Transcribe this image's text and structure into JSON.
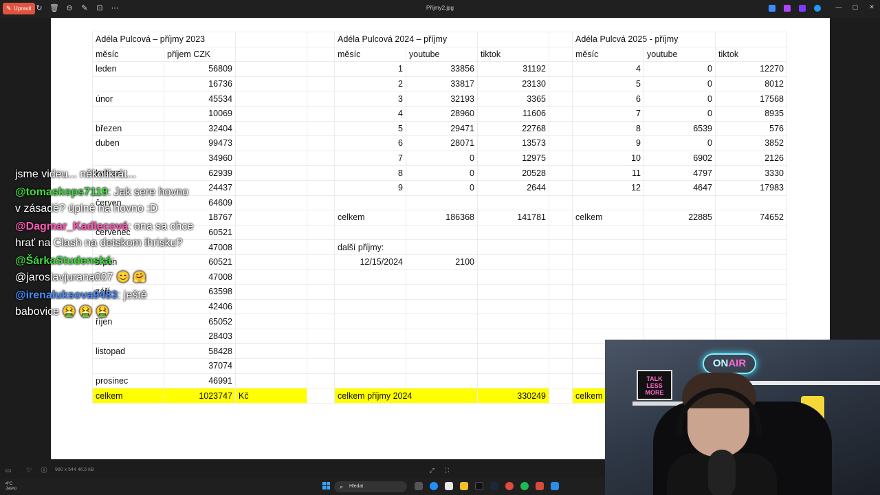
{
  "viewer": {
    "edit_label": "Upravit",
    "file_title": "Příjmy2.jpg",
    "image_info": "960 x 544   46.5 kB"
  },
  "sheet": {
    "t2023_title": "Adéla Pulcová – příjmy 2023",
    "t2024_title": "Adéla Pulcová 2024 – příjmy",
    "t2025_title": "Adéla Pulcvá 2025 - příjmy",
    "col_mesic": "měsíc",
    "col_prijem": "příjem CZK",
    "col_youtube": "youtube",
    "col_tiktok": "tiktok",
    "rows": [
      {
        "m23": "leden",
        "v23": "56809",
        "m24": "1",
        "y24": "33856",
        "t24": "31192",
        "m25": "4",
        "y25": "0",
        "t25": "12270"
      },
      {
        "m23": "",
        "v23": "16736",
        "m24": "2",
        "y24": "33817",
        "t24": "23130",
        "m25": "5",
        "y25": "0",
        "t25": "8012"
      },
      {
        "m23": "únor",
        "v23": "45534",
        "m24": "3",
        "y24": "32193",
        "t24": "3365",
        "m25": "6",
        "y25": "0",
        "t25": "17568"
      },
      {
        "m23": "",
        "v23": "10069",
        "m24": "4",
        "y24": "28960",
        "t24": "11606",
        "m25": "7",
        "y25": "0",
        "t25": "8935"
      },
      {
        "m23": "březen",
        "v23": "32404",
        "m24": "5",
        "y24": "29471",
        "t24": "22768",
        "m25": "8",
        "y25": "6539",
        "t25": "576"
      },
      {
        "m23": "duben",
        "v23": "99473",
        "m24": "6",
        "y24": "28071",
        "t24": "13573",
        "m25": "9",
        "y25": "0",
        "t25": "3852"
      },
      {
        "m23": "",
        "v23": "34960",
        "m24": "7",
        "y24": "0",
        "t24": "12975",
        "m25": "10",
        "y25": "6902",
        "t25": "2126"
      },
      {
        "m23": "květen",
        "v23": "62939",
        "m24": "8",
        "y24": "0",
        "t24": "20528",
        "m25": "11",
        "y25": "4797",
        "t25": "3330"
      },
      {
        "m23": "",
        "v23": "24437",
        "m24": "9",
        "y24": "0",
        "t24": "2644",
        "m25": "12",
        "y25": "4647",
        "t25": "17983"
      },
      {
        "m23": "červen",
        "v23": "64609",
        "m24": "",
        "y24": "",
        "t24": "",
        "m25": "",
        "y25": "",
        "t25": ""
      },
      {
        "m23": "",
        "v23": "18767",
        "m24": "celkem",
        "y24": "186368",
        "t24": "141781",
        "m25": "celkem",
        "y25": "22885",
        "t25": "74652"
      },
      {
        "m23": "červenec",
        "v23": "60521",
        "m24": "",
        "y24": "",
        "t24": "",
        "m25": "",
        "y25": "",
        "t25": ""
      },
      {
        "m23": "",
        "v23": "47008",
        "m24": "další příjmy:",
        "y24": "",
        "t24": "",
        "m25": "",
        "y25": "",
        "t25": ""
      },
      {
        "m23": "srpen",
        "v23": "60521",
        "m24": "12/15/2024",
        "y24": "2100",
        "t24": "",
        "m25": "",
        "y25": "",
        "t25": ""
      },
      {
        "m23": "",
        "v23": "47008",
        "m24": "",
        "y24": "",
        "t24": "",
        "m25": "",
        "y25": "",
        "t25": ""
      },
      {
        "m23": "září",
        "v23": "63598",
        "m24": "",
        "y24": "",
        "t24": "",
        "m25": "",
        "y25": "",
        "t25": ""
      },
      {
        "m23": "",
        "v23": "42406",
        "m24": "",
        "y24": "",
        "t24": "",
        "m25": "",
        "y25": "",
        "t25": ""
      },
      {
        "m23": "říjen",
        "v23": "65052",
        "m24": "",
        "y24": "",
        "t24": "",
        "m25": "",
        "y25": "",
        "t25": ""
      },
      {
        "m23": "",
        "v23": "28403",
        "m24": "",
        "y24": "",
        "t24": "",
        "m25": "",
        "y25": "",
        "t25": ""
      },
      {
        "m23": "listopad",
        "v23": "58428",
        "m24": "",
        "y24": "",
        "t24": "",
        "m25": "",
        "y25": "",
        "t25": ""
      },
      {
        "m23": "",
        "v23": "37074",
        "m24": "",
        "y24": "",
        "t24": "",
        "m25": "",
        "y25": "",
        "t25": ""
      },
      {
        "m23": "prosinec",
        "v23": "46991",
        "m24": "",
        "y24": "",
        "t24": "",
        "m25": "",
        "y25": "",
        "t25": ""
      }
    ],
    "total_2023_label": "celkem",
    "total_2023_value": "1023747",
    "total_2023_unit": "Kč",
    "total_2024_label": "celkem příjmy 2024",
    "total_2024_value": "330249",
    "total_2025_label": "celkem"
  },
  "chat": [
    {
      "user": "",
      "user_color": "#ffffff",
      "text": "jsme videu... několikrát..."
    },
    {
      "user": "@tomaskops7119",
      "user_color": "#3fdc3f",
      "text": ": Jak sere hovno v zásadě? úplně na hovno :D"
    },
    {
      "user": "@Dagmar_Kadlecová",
      "user_color": "#ff5ab4",
      "text": ": ona sa chce hrať na Clash na detskom ihrisku?"
    },
    {
      "user": "@ŠárkaStudenská",
      "user_color": "#3fdc3f",
      "text": ": @jaroslavjurana007 😊 🤗"
    },
    {
      "user": "@irenaluksova9483",
      "user_color": "#4a8cff",
      "text": ": ještě babovice 🤮 🤮 🤮"
    }
  ],
  "webcam": {
    "neon_on": "ON",
    "neon_air": "AIR",
    "poster_text": "TALK LESS MORE"
  },
  "taskbar": {
    "weather_temp": "4°C",
    "weather_desc": "Jasno",
    "search_placeholder": "Hledat"
  },
  "colors": {
    "highlight": "#ffff00",
    "edit_button": "#e0533f",
    "taskbar": "#1f1f1f"
  }
}
